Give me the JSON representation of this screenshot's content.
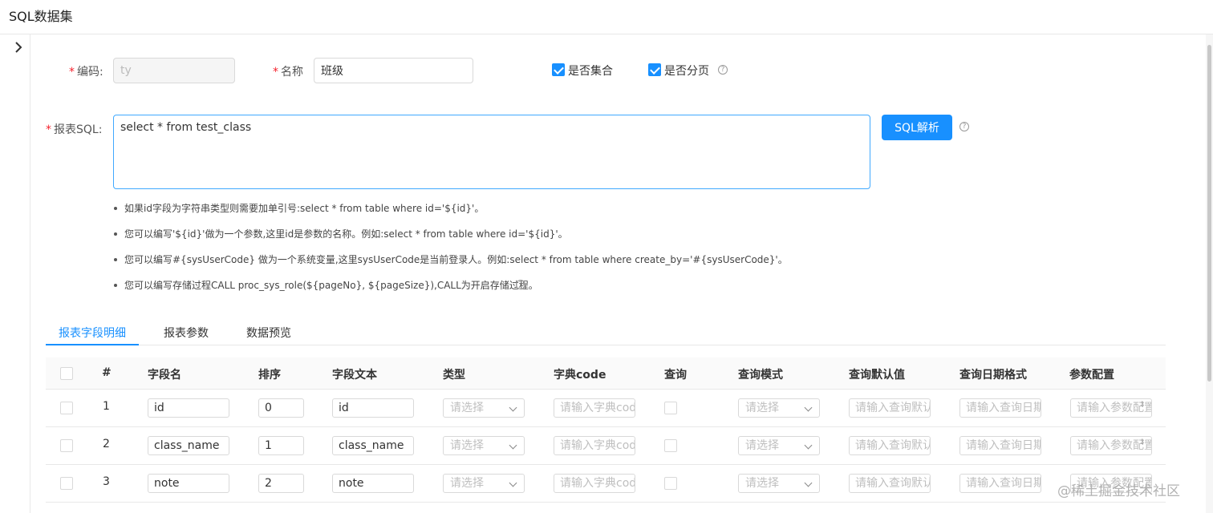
{
  "window": {
    "title": "SQL数据集"
  },
  "form": {
    "code": {
      "label": "编码:",
      "value": "ty"
    },
    "name": {
      "label": "名称",
      "value": "班级"
    },
    "is_collection": {
      "label": "是否集合",
      "checked": true
    },
    "is_paged": {
      "label": "是否分页",
      "checked": true
    },
    "sql": {
      "label": "报表SQL:",
      "value": "select * from test_class"
    },
    "parse_button": "SQL解析"
  },
  "tips": [
    "如果id字段为字符串类型则需要加单引号:select * from table where id='${id}'。",
    "您可以编写'${id}'做为一个参数,这里id是参数的名称。例如:select * from table where id='${id}'。",
    "您可以编写#{sysUserCode} 做为一个系统变量,这里sysUserCode是当前登录人。例如:select * from table where create_by='#{sysUserCode}'。",
    "您可以编写存储过程CALL proc_sys_role(${pageNo}, ${pageSize}),CALL为开启存储过程。"
  ],
  "tabs": [
    "报表字段明细",
    "报表参数",
    "数据预览"
  ],
  "table": {
    "headers": [
      "#",
      "字段名",
      "排序",
      "字段文本",
      "类型",
      "字典code",
      "查询",
      "查询模式",
      "查询默认值",
      "查询日期格式",
      "参数配置"
    ],
    "placeholders": {
      "type": "请选择",
      "dict_code": "请输入字典code",
      "query_mode": "请选择",
      "default_value": "请输入查询默认值",
      "date_format": "请输入查询日期格式",
      "param_config": "请输入参数配置"
    },
    "rows": [
      {
        "index": "1",
        "field_name": "id",
        "order": "0",
        "field_text": "id"
      },
      {
        "index": "2",
        "field_name": "class_name",
        "order": "1",
        "field_text": "class_name"
      },
      {
        "index": "3",
        "field_name": "note",
        "order": "2",
        "field_text": "note"
      }
    ]
  },
  "watermark": "@稀土掘金技术社区",
  "colors": {
    "primary": "#1890ff",
    "required": "#f5222d"
  }
}
